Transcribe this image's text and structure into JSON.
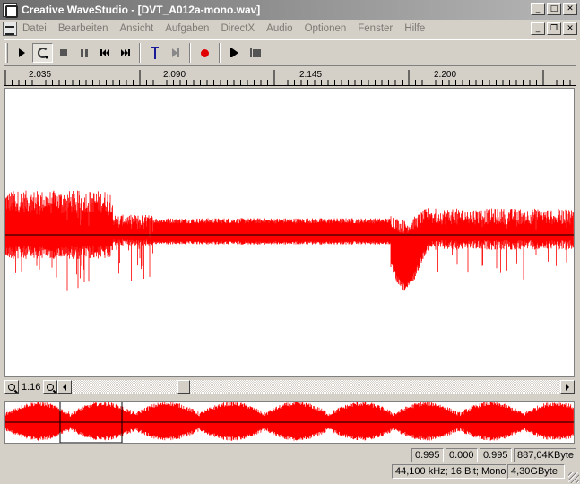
{
  "window": {
    "title": "Creative WaveStudio - [DVT_A012a-mono.wav]",
    "minimize_glyph": "_",
    "maximize_glyph": "□",
    "close_glyph": "✕",
    "restore_glyph": "❐"
  },
  "menu": {
    "items": [
      "Datei",
      "Bearbeiten",
      "Ansicht",
      "Aufgaben",
      "DirectX",
      "Audio",
      "Optionen",
      "Fenster",
      "Hilfe"
    ]
  },
  "toolbar": {
    "icons": [
      "play-icon",
      "loop-play-icon",
      "stop-icon",
      "pause-icon",
      "skip-back-icon",
      "skip-forward-icon",
      "marker-icon",
      "play-to-marker-icon",
      "record-icon",
      "play-selection-icon",
      "stop-selection-icon"
    ]
  },
  "ruler": {
    "labels": [
      "2.035",
      "2.090",
      "2.145",
      "2.200"
    ]
  },
  "zoom": {
    "level": "1:16"
  },
  "status": {
    "sel_start": "0.995",
    "sel_length": "0.000",
    "sel_end": "0.995",
    "file_size": "887,04KByte",
    "format": "44,100 kHz; 16 Bit; Mono",
    "disk_free": "4,30GByte"
  },
  "colors": {
    "waveform": "#ff0000",
    "title_gradient_start": "#6e6e6e",
    "title_gradient_end": "#b6b6b6",
    "background": "#d4d0c8"
  }
}
